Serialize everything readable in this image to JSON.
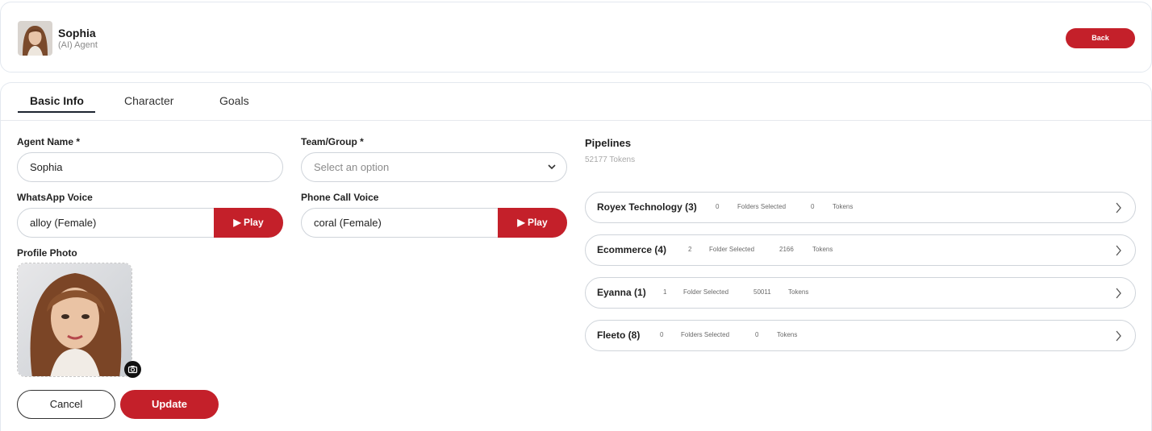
{
  "header": {
    "agent_name": "Sophia",
    "agent_role": "(AI) Agent",
    "back_label": "Back"
  },
  "tabs": [
    {
      "label": "Basic Info",
      "active": true
    },
    {
      "label": "Character",
      "active": false
    },
    {
      "label": "Goals",
      "active": false
    }
  ],
  "form": {
    "agent_name_label": "Agent Name *",
    "agent_name_value": "Sophia",
    "team_label": "Team/Group *",
    "team_placeholder": "Select an option",
    "whatsapp_label": "WhatsApp Voice",
    "whatsapp_value": "alloy (Female)",
    "phone_label": "Phone Call Voice",
    "phone_value": "coral (Female)",
    "play_label": "▶ Play",
    "profile_label": "Profile Photo",
    "cancel_label": "Cancel",
    "update_label": "Update"
  },
  "pipelines": {
    "title": "Pipelines",
    "subtitle": "52177 Tokens",
    "items": [
      {
        "name": "Royex Technology (3)",
        "count": "0",
        "folders_label": "Folders Selected",
        "tokens": "0",
        "tokens_label": "Tokens"
      },
      {
        "name": "Ecommerce (4)",
        "count": "2",
        "folders_label": "Folder Selected",
        "tokens": "2166",
        "tokens_label": "Tokens"
      },
      {
        "name": "Eyanna (1)",
        "count": "1",
        "folders_label": "Folder Selected",
        "tokens": "50011",
        "tokens_label": "Tokens"
      },
      {
        "name": "Fleeto (8)",
        "count": "0",
        "folders_label": "Folders Selected",
        "tokens": "0",
        "tokens_label": "Tokens"
      }
    ]
  },
  "colors": {
    "accent": "#c4202a",
    "border": "#cfd4da"
  },
  "icons": [
    "chevron-down-icon",
    "play-icon",
    "camera-icon",
    "chevron-right-icon"
  ]
}
